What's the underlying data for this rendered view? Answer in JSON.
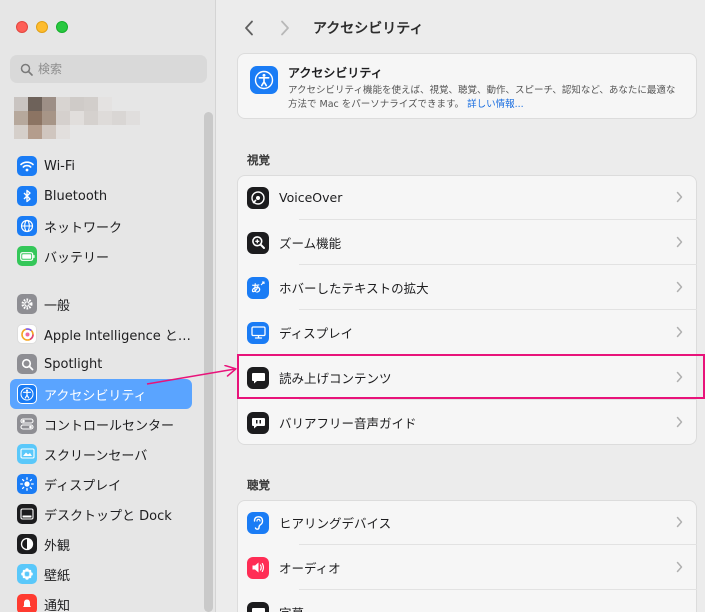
{
  "search": {
    "placeholder": "検索"
  },
  "sidebar": {
    "items": [
      {
        "label": "Wi-Fi",
        "icon": "wifi-icon",
        "color": "#1a7cf5"
      },
      {
        "label": "Bluetooth",
        "icon": "bluetooth-icon",
        "color": "#1a7cf5"
      },
      {
        "label": "ネットワーク",
        "icon": "globe-icon",
        "color": "#1a7cf5"
      },
      {
        "label": "バッテリー",
        "icon": "battery-icon",
        "color": "#34c759"
      },
      {
        "label": "一般",
        "icon": "gear-icon",
        "color": "#8e8e93"
      },
      {
        "label": "Apple Intelligence と…",
        "icon": "apple-intelligence-icon",
        "color": "#ffffff"
      },
      {
        "label": "Spotlight",
        "icon": "magnifier-icon",
        "color": "#8e8e93"
      },
      {
        "label": "アクセシビリティ",
        "icon": "accessibility-icon",
        "color": "#1a7cf5",
        "selected": true
      },
      {
        "label": "コントロールセンター",
        "icon": "control-center-icon",
        "color": "#8e8e93"
      },
      {
        "label": "スクリーンセーバ",
        "icon": "screensaver-icon",
        "color": "#5ac8fa"
      },
      {
        "label": "ディスプレイ",
        "icon": "sun-icon",
        "color": "#1a7cf5"
      },
      {
        "label": "デスクトップと Dock",
        "icon": "dock-icon",
        "color": "#1c1c1e"
      },
      {
        "label": "外観",
        "icon": "appearance-icon",
        "color": "#1c1c1e"
      },
      {
        "label": "壁紙",
        "icon": "wallpaper-icon",
        "color": "#5ac8fa"
      },
      {
        "label": "通知",
        "icon": "notification-icon",
        "color": "#ff3b30"
      }
    ]
  },
  "main": {
    "title": "アクセシビリティ",
    "intro": {
      "title": "アクセシビリティ",
      "description": "アクセシビリティ機能を使えば、視覚、聴覚、動作、スピーチ、認知など、あなたに最適な方法で Mac をパーソナライズできます。",
      "link": "詳しい情報..."
    },
    "sections": [
      {
        "title": "視覚",
        "rows": [
          {
            "label": "VoiceOver",
            "icon": "voiceover-icon"
          },
          {
            "label": "ズーム機能",
            "icon": "zoom-icon"
          },
          {
            "label": "ホバーしたテキストの拡大",
            "icon": "hover-text-icon"
          },
          {
            "label": "ディスプレイ",
            "icon": "display-icon"
          },
          {
            "label": "読み上げコンテンツ",
            "icon": "spoken-content-icon"
          },
          {
            "label": "バリアフリー音声ガイド",
            "icon": "audio-description-icon"
          }
        ]
      },
      {
        "title": "聴覚",
        "rows": [
          {
            "label": "ヒアリングデバイス",
            "icon": "hearing-icon"
          },
          {
            "label": "オーディオ",
            "icon": "speaker-icon"
          },
          {
            "label": "字幕",
            "icon": "captions-icon"
          }
        ]
      }
    ]
  },
  "colors": {
    "selected": "#5aa4ff",
    "highlight": "#e8137a",
    "accent": "#1a7cf5"
  }
}
